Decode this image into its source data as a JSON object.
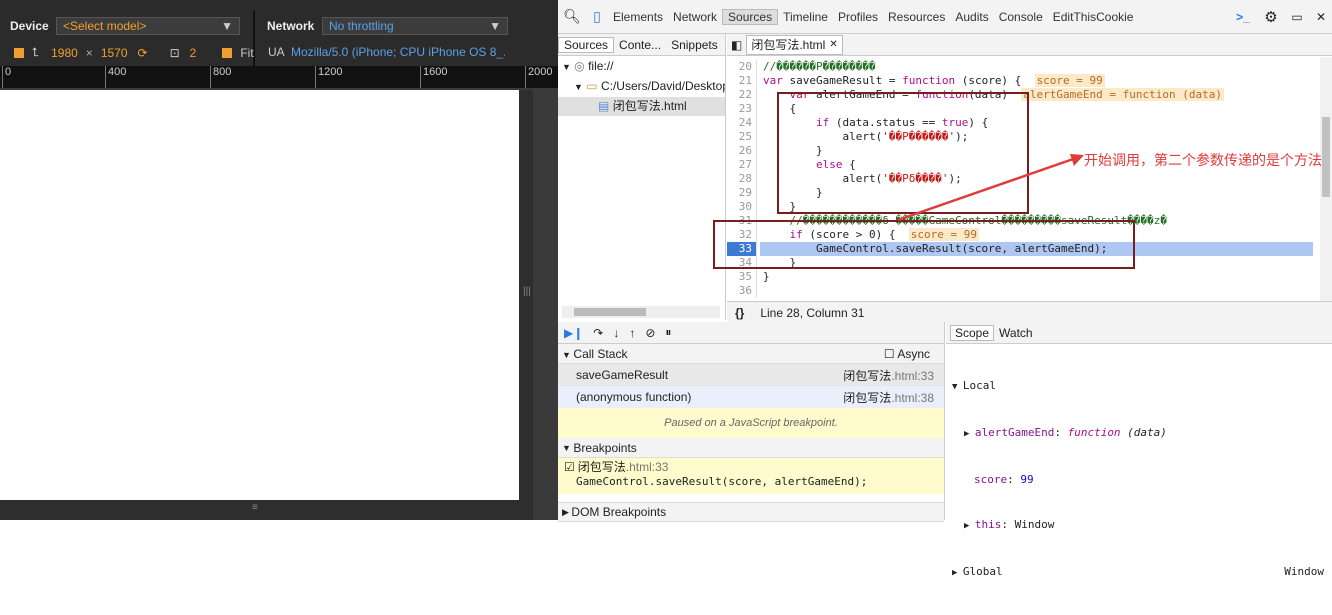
{
  "emulation": {
    "device_label": "Device",
    "device_select": "<Select model>",
    "network_label": "Network",
    "network_select": "No throttling",
    "width": "1980",
    "times": "×",
    "height": "1570",
    "dpr": "2",
    "fit_label": "Fit",
    "ua_label": "UA",
    "ua_value": "Mozilla/5.0 (iPhone; CPU iPhone OS 8_...",
    "ruler": [
      "0",
      "400",
      "800",
      "1200",
      "1600",
      "2000"
    ]
  },
  "devtools": {
    "tabs": [
      "Elements",
      "Network",
      "Sources",
      "Timeline",
      "Profiles",
      "Resources",
      "Audits",
      "Console",
      "EditThisCookie"
    ],
    "active_tab": "Sources",
    "nav_tabs": [
      "Sources",
      "Conte...",
      "Snippets"
    ],
    "tree": [
      "file://",
      "C:/Users/David/Desktop",
      "闭包写法.html"
    ],
    "file_tab": "闭包写法.html",
    "status_text": "Line 28, Column 31",
    "code_lines": [
      {
        "n": "20"
      },
      {
        "n": "21"
      },
      {
        "n": "22"
      },
      {
        "n": "23"
      },
      {
        "n": "24"
      },
      {
        "n": "25"
      },
      {
        "n": "26"
      },
      {
        "n": "27"
      },
      {
        "n": "28"
      },
      {
        "n": "29"
      },
      {
        "n": "30"
      },
      {
        "n": "31"
      },
      {
        "n": "32"
      },
      {
        "n": "33"
      },
      {
        "n": "34"
      },
      {
        "n": "35"
      },
      {
        "n": "36"
      }
    ],
    "code_text": {
      "l20": "//������P��������",
      "l21a": "var",
      "l21b": " saveGameResult = ",
      "l21c": "function",
      "l21d": " (score) {",
      "l21e": "score = 99",
      "l22a": "    var",
      "l22b": " alertGameEnd = ",
      "l22c": "function",
      "l22d": "(data)",
      "l22e": "alertGameEnd = function (data)",
      "l23": "    {",
      "l24a": "        if",
      "l24b": " (data.status == ",
      "l24c": "true",
      "l24d": ") {",
      "l25a": "            alert(",
      "l25b": "'��P������'",
      "l25c": ");",
      "l26": "        }",
      "l27a": "        else",
      "l27b": " {",
      "l28a": "            alert(",
      "l28b": "'��Pδ����'",
      "l28c": ");",
      "l29": "        }",
      "l30": "    }",
      "l31": "    //������������δ �����GameControl���������saveResult����z�",
      "l32a": "    if",
      "l32b": " (score > 0) {",
      "l32c": "score = 99",
      "l33": "        GameControl.saveResult(score, alertGameEnd);",
      "l34": "    }",
      "l35": "}",
      "l36": ""
    },
    "annotation": "开始调用，第二个参数传递的是个方法",
    "call_stack_title": "Call Stack",
    "async_label": "Async",
    "call_stack": [
      {
        "fn": "saveGameResult",
        "loc": "闭包写法",
        "loc2": ".html:33"
      },
      {
        "fn": "(anonymous function)",
        "loc": "闭包写法",
        "loc2": ".html:38"
      }
    ],
    "paused_msg": "Paused on a JavaScript breakpoint.",
    "breakpoints_title": "Breakpoints",
    "bp_file": "闭包写法",
    "bp_line": ".html:33",
    "bp_code": "GameControl.saveResult(score, alertGameEnd);",
    "dom_bp_title": "DOM Breakpoints",
    "scope_tabs": [
      "Scope",
      "Watch"
    ],
    "scope": {
      "local_title": "Local",
      "v1_name": "alertGameEnd",
      "v1_val_kw": "function",
      "v1_val": " (data)",
      "v2_name": "score",
      "v2_val": "99",
      "v3_name": "this",
      "v3_val": "Window",
      "global_title": "Global",
      "global_val": "Window"
    }
  },
  "colors": {
    "accent_orange": "#f0a030",
    "accent_blue": "#5aa0e6",
    "annotation": "#e03a3a",
    "box": "#7a1d1d"
  }
}
